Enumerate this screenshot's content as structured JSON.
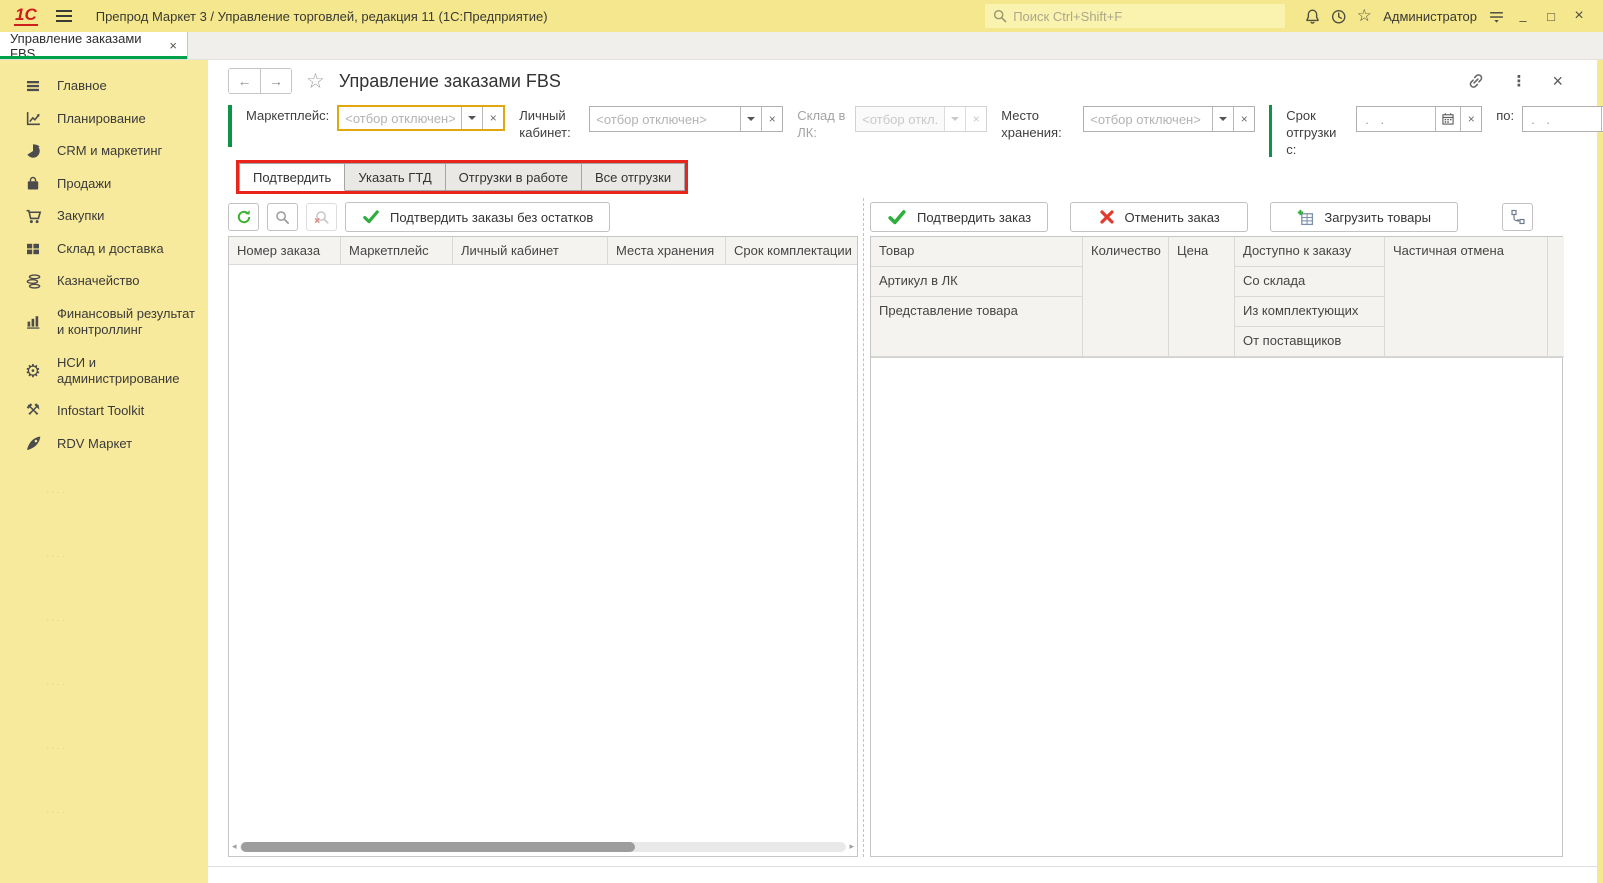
{
  "colors": {
    "titlebar_bg": "#f5e78d",
    "sidebar_bg": "#f8ea9c",
    "brand_red": "#cf1d1c",
    "accent_green": "#00a14b",
    "focus_gold": "#e2a70c",
    "annotation_red": "#ea231c",
    "confirm_green": "#2fae3e",
    "cancel_red": "#e23b2e"
  },
  "titlebar": {
    "logo_text": "1С",
    "title": "Препрод Маркет 3 / Управление торговлей, редакция 11  (1С:Предприятие)",
    "search_placeholder": "Поиск Ctrl+Shift+F",
    "user_name": "Администратор"
  },
  "icons": {
    "back": "←",
    "forward": "→",
    "star": "☆",
    "kebab": "⋮",
    "close": "×",
    "minimize": "–",
    "maximize": "□",
    "gear": "⚙",
    "tools": "⚒",
    "scroll_left": "◂",
    "scroll_right": "▸"
  },
  "window_tab": {
    "label": "Управление заказами FBS"
  },
  "sidebar": {
    "items": [
      {
        "label": "Главное",
        "icon": "menu-lines-icon"
      },
      {
        "label": "Планирование",
        "icon": "planning-chart-icon"
      },
      {
        "label": "CRM и маркетинг",
        "icon": "pie-chart-icon"
      },
      {
        "label": "Продажи",
        "icon": "briefcase-icon"
      },
      {
        "label": "Закупки",
        "icon": "cart-icon"
      },
      {
        "label": "Склад и доставка",
        "icon": "warehouse-grid-icon"
      },
      {
        "label": "Казначейство",
        "icon": "coins-icon"
      },
      {
        "label": "Финансовый результат и контроллинг",
        "icon": "bar-chart-icon"
      },
      {
        "label": "НСИ и администрирование",
        "icon": "gear-icon"
      },
      {
        "label": "Infostart Toolkit",
        "icon": "tools-icon"
      },
      {
        "label": "RDV Маркет",
        "icon": "rocket-icon"
      }
    ]
  },
  "page": {
    "title": "Управление заказами FBS",
    "filters": {
      "marketplace_label": "Маркетплейс:",
      "marketplace_placeholder": "<отбор отключен>",
      "account_label": "Личный кабинет:",
      "account_placeholder": "<отбор отключен>",
      "warehouse_label": "Склад в ЛК:",
      "warehouse_placeholder": "<отбор откл...",
      "storage_label": "Место хранения:",
      "storage_placeholder": "<отбор отключен>",
      "ship_from_label": "Срок отгрузки с:",
      "ship_from_value": ". .",
      "ship_to_label": "по:",
      "ship_to_value": ". ."
    },
    "command_tabs": [
      {
        "label": "Подтвердить"
      },
      {
        "label": "Указать ГТД"
      },
      {
        "label": "Отгрузки в работе"
      },
      {
        "label": "Все отгрузки"
      }
    ],
    "orders_panel": {
      "confirm_no_stock_button": "Подтвердить заказы без остатков",
      "columns": [
        "Номер заказа",
        "Маркетплейс",
        "Личный кабинет",
        "Места хранения",
        "Срок комплектации"
      ],
      "rows": []
    },
    "items_panel": {
      "confirm_button": "Подтвердить заказ",
      "cancel_button": "Отменить заказ",
      "load_button": "Загрузить товары",
      "header": {
        "product": "Товар",
        "article": "Артикул в ЛК",
        "presentation": "Представление товара",
        "quantity": "Количество",
        "price": "Цена",
        "available": "Доступно к заказу",
        "from_stock": "Со склада",
        "from_components": "Из комплектующих",
        "from_suppliers": "От поставщиков",
        "partial_cancel": "Частичная отмена"
      },
      "rows": []
    }
  }
}
